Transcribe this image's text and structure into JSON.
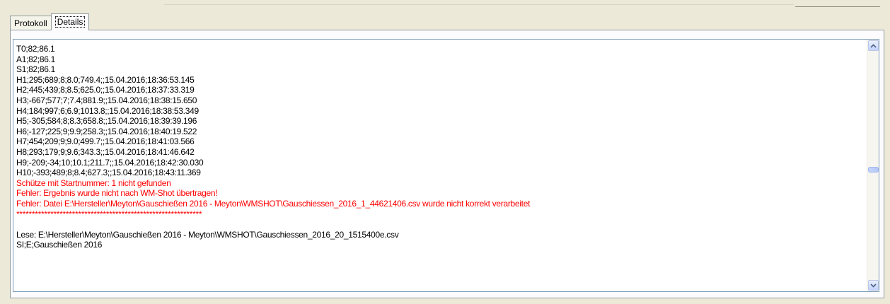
{
  "tabs": [
    {
      "label": "Protokoll"
    },
    {
      "label": "Details"
    }
  ],
  "log": {
    "lines": [
      {
        "text": "T0;82;86.1",
        "type": "normal"
      },
      {
        "text": "A1;82;86.1",
        "type": "normal"
      },
      {
        "text": "S1;82;86.1",
        "type": "normal"
      },
      {
        "text": "H1;295;689;8;8.0;749.4;;15.04.2016;18:36:53.145",
        "type": "normal"
      },
      {
        "text": "H2;445;439;8;8.5;625.0;;15.04.2016;18:37:33.319",
        "type": "normal"
      },
      {
        "text": "H3;-667;577;7;7.4;881.9;;15.04.2016;18:38:15.650",
        "type": "normal"
      },
      {
        "text": "H4;184;997;6;6.9;1013.8;;15.04.2016;18:38:53.349",
        "type": "normal"
      },
      {
        "text": "H5;-305;584;8;8.3;658.8;;15.04.2016;18:39:39.196",
        "type": "normal"
      },
      {
        "text": "H6;-127;225;9;9.9;258.3;;15.04.2016;18:40:19.522",
        "type": "normal"
      },
      {
        "text": "H7;454;209;9;9.0;499.7;;15.04.2016;18:41:03.566",
        "type": "normal"
      },
      {
        "text": "H8;293;179;9;9.6;343.3;;15.04.2016;18:41:46.642",
        "type": "normal"
      },
      {
        "text": "H9;-209;-34;10;10.1;211.7;;15.04.2016;18:42:30.030",
        "type": "normal"
      },
      {
        "text": "H10;-393;489;8;8.4;627.3;;15.04.2016;18:43:11.369",
        "type": "normal"
      },
      {
        "text": "Schütze mit Startnummer: 1 nicht gefunden",
        "type": "error"
      },
      {
        "text": "Fehler: Ergebnis wurde nicht nach WM-Shot übertragen!",
        "type": "error"
      },
      {
        "text": "Fehler: Datei E:\\Hersteller\\Meyton\\Gauschießen 2016 - Meyton\\WMSHOT\\Gauschiessen_2016_1_44621406.csv wurde nicht korrekt verarbeitet",
        "type": "error"
      },
      {
        "text": "************************************************************",
        "type": "error"
      },
      {
        "text": "",
        "type": "normal"
      },
      {
        "text": "Lese: E:\\Hersteller\\Meyton\\Gauschießen 2016 - Meyton\\WMSHOT\\Gauschiessen_2016_20_1515400e.csv",
        "type": "normal"
      },
      {
        "text": "SI;E;Gauschießen 2016",
        "type": "normal"
      }
    ]
  },
  "scrollbar": {
    "position": 0.52
  },
  "colors": {
    "error": "#ff0000",
    "normal": "#000000",
    "tab_border": "#919b9c",
    "memo_border": "#7f9db9"
  },
  "icons": {
    "scroll_up": "arrow-up-icon",
    "scroll_down": "arrow-down-icon"
  }
}
